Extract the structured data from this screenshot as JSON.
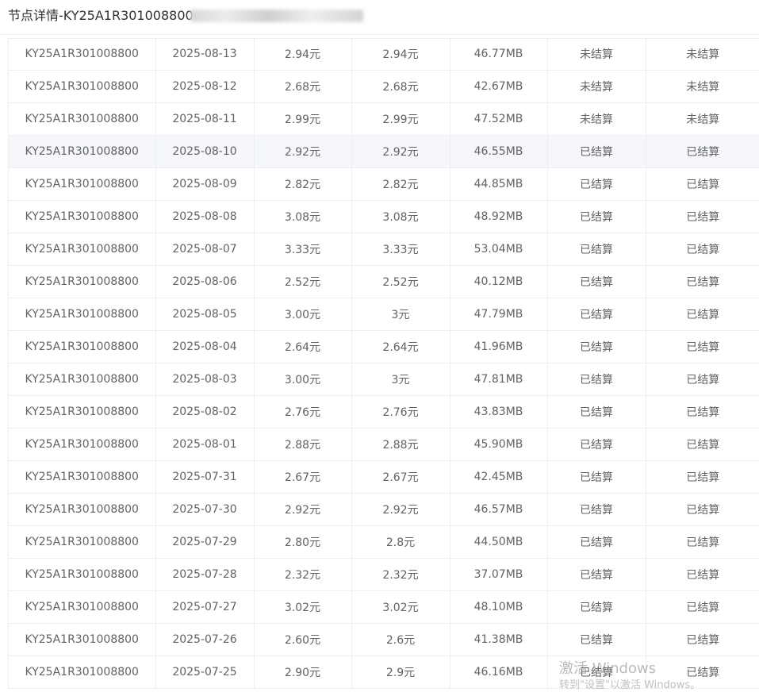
{
  "page": {
    "title": "节点详情-KY25A1R301008800"
  },
  "table": {
    "rows": [
      [
        "KY25A1R301008800",
        "2025-08-13",
        "2.94元",
        "2.94元",
        "46.77MB",
        "未结算",
        "未结算"
      ],
      [
        "KY25A1R301008800",
        "2025-08-12",
        "2.68元",
        "2.68元",
        "42.67MB",
        "未结算",
        "未结算"
      ],
      [
        "KY25A1R301008800",
        "2025-08-11",
        "2.99元",
        "2.99元",
        "47.52MB",
        "未结算",
        "未结算"
      ],
      [
        "KY25A1R301008800",
        "2025-08-10",
        "2.92元",
        "2.92元",
        "46.55MB",
        "已结算",
        "已结算"
      ],
      [
        "KY25A1R301008800",
        "2025-08-09",
        "2.82元",
        "2.82元",
        "44.85MB",
        "已结算",
        "已结算"
      ],
      [
        "KY25A1R301008800",
        "2025-08-08",
        "3.08元",
        "3.08元",
        "48.92MB",
        "已结算",
        "已结算"
      ],
      [
        "KY25A1R301008800",
        "2025-08-07",
        "3.33元",
        "3.33元",
        "53.04MB",
        "已结算",
        "已结算"
      ],
      [
        "KY25A1R301008800",
        "2025-08-06",
        "2.52元",
        "2.52元",
        "40.12MB",
        "已结算",
        "已结算"
      ],
      [
        "KY25A1R301008800",
        "2025-08-05",
        "3.00元",
        "3元",
        "47.79MB",
        "已结算",
        "已结算"
      ],
      [
        "KY25A1R301008800",
        "2025-08-04",
        "2.64元",
        "2.64元",
        "41.96MB",
        "已结算",
        "已结算"
      ],
      [
        "KY25A1R301008800",
        "2025-08-03",
        "3.00元",
        "3元",
        "47.81MB",
        "已结算",
        "已结算"
      ],
      [
        "KY25A1R301008800",
        "2025-08-02",
        "2.76元",
        "2.76元",
        "43.83MB",
        "已结算",
        "已结算"
      ],
      [
        "KY25A1R301008800",
        "2025-08-01",
        "2.88元",
        "2.88元",
        "45.90MB",
        "已结算",
        "已结算"
      ],
      [
        "KY25A1R301008800",
        "2025-07-31",
        "2.67元",
        "2.67元",
        "42.45MB",
        "已结算",
        "已结算"
      ],
      [
        "KY25A1R301008800",
        "2025-07-30",
        "2.92元",
        "2.92元",
        "46.57MB",
        "已结算",
        "已结算"
      ],
      [
        "KY25A1R301008800",
        "2025-07-29",
        "2.80元",
        "2.8元",
        "44.50MB",
        "已结算",
        "已结算"
      ],
      [
        "KY25A1R301008800",
        "2025-07-28",
        "2.32元",
        "2.32元",
        "37.07MB",
        "已结算",
        "已结算"
      ],
      [
        "KY25A1R301008800",
        "2025-07-27",
        "3.02元",
        "3.02元",
        "48.10MB",
        "已结算",
        "已结算"
      ],
      [
        "KY25A1R301008800",
        "2025-07-26",
        "2.60元",
        "2.6元",
        "41.38MB",
        "已结算",
        "已结算"
      ],
      [
        "KY25A1R301008800",
        "2025-07-25",
        "2.90元",
        "2.9元",
        "46.16MB",
        "已结算",
        "已结算"
      ]
    ],
    "highlighted_row": 3
  },
  "watermark": {
    "line1": "激活 Windows",
    "line2": "转到\"设置\"以激活 Windows。"
  }
}
